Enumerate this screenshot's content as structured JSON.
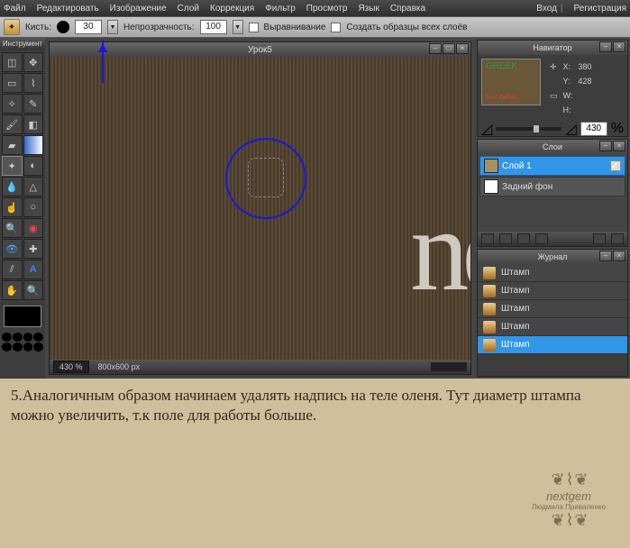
{
  "menu": {
    "file": "Файл",
    "edit": "Редактировать",
    "image": "Изображение",
    "layer": "Слой",
    "adjust": "Коррекция",
    "filter": "Фильтр",
    "view": "Просмотр",
    "lang": "Язык",
    "help": "Справка",
    "login": "Вход",
    "register": "Регистрация"
  },
  "options": {
    "brush_label": "Кисть:",
    "brush_size": "30",
    "opacity_label": "Непрозрачность:",
    "opacity_val": "100",
    "align_label": "Выравнивание",
    "sample_label": "Создать образцы всех слоёв"
  },
  "tools_title": "Инструмент",
  "doc": {
    "title": "Урок5",
    "zoom": "430 %",
    "dims": "800x600 px",
    "letters": "ne"
  },
  "nav": {
    "title": "Навигатор",
    "x_label": "X:",
    "x": "380",
    "y_label": "Y:",
    "y": "428",
    "w_label": "W:",
    "h_label": "H:",
    "zoom": "430",
    "pct": "%",
    "thumb_top": "GREEK",
    "thumb_bot": "text belter"
  },
  "layers": {
    "title": "Слои",
    "l1": "Слой 1",
    "bg": "Задний фон"
  },
  "history": {
    "title": "Журнал",
    "item": "Штамп"
  },
  "caption": "5.Аналогичным образом начинаем удалять надпись на теле оленя. Тут диаметр штампа можно увеличить, т.к  поле для работы больше.",
  "sig": {
    "name": "nextgem",
    "sub": "Людмила Приваленко"
  }
}
